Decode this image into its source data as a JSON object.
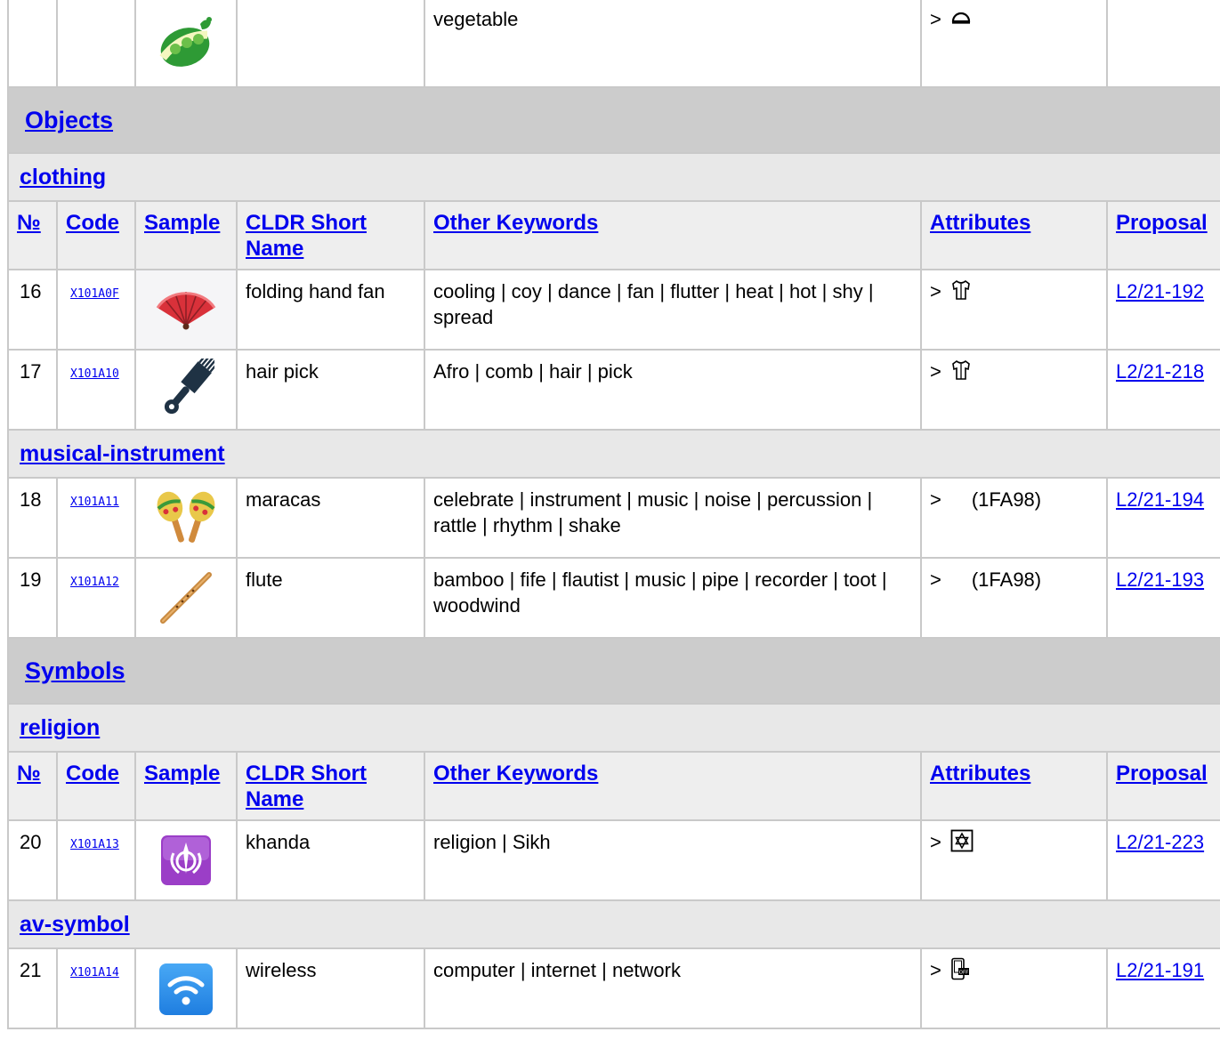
{
  "top_row": {
    "keywords": "vegetable",
    "attr_arrow": ">",
    "icon": "vegetable-emoji-icon"
  },
  "headers": {
    "no": "№",
    "code": "Code",
    "sample": "Sample",
    "name": "CLDR Short Name",
    "keywords": "Other Keywords",
    "attributes": "Attributes",
    "proposal": "Proposal"
  },
  "sections": [
    {
      "title": "Objects",
      "subgroups": [
        {
          "title": "clothing",
          "rows": [
            {
              "no": "16",
              "code": "X101A0F",
              "icon": "folding-fan-icon",
              "name": "folding hand fan",
              "keywords": "cooling | coy | dance | fan | flutter | heat | hot | shy | spread",
              "arrow": ">",
              "attr_icon": "shirt-icon",
              "proposal": "L2/21-192"
            },
            {
              "no": "17",
              "code": "X101A10",
              "icon": "hair-pick-icon",
              "name": "hair pick",
              "keywords": "Afro | comb | hair | pick",
              "arrow": ">",
              "attr_icon": "shirt-icon",
              "proposal": "L2/21-218"
            }
          ]
        },
        {
          "title": "musical-instrument",
          "rows": [
            {
              "no": "18",
              "code": "X101A11",
              "icon": "maracas-icon",
              "name": "maracas",
              "keywords": "celebrate | instrument | music | noise | percussion | rattle | rhythm | shake",
              "arrow": ">",
              "attr_text": "(1FA98)",
              "proposal": "L2/21-194"
            },
            {
              "no": "19",
              "code": "X101A12",
              "icon": "flute-icon",
              "name": "flute",
              "keywords": "bamboo | fife | flautist | music | pipe | recorder | toot | woodwind",
              "arrow": ">",
              "attr_text": "(1FA98)",
              "proposal": "L2/21-193"
            }
          ]
        }
      ]
    },
    {
      "title": "Symbols",
      "subgroups": [
        {
          "title": "religion",
          "rows": [
            {
              "no": "20",
              "code": "X101A13",
              "icon": "khanda-icon",
              "name": "khanda",
              "keywords": "religion | Sikh",
              "arrow": ">",
              "attr_icon": "star-of-david-box-icon",
              "proposal": "L2/21-223"
            }
          ]
        },
        {
          "title": "av-symbol",
          "rows": [
            {
              "no": "21",
              "code": "X101A14",
              "icon": "wireless-icon",
              "name": "wireless",
              "keywords": "computer | internet | network",
              "arrow": ">",
              "attr_icon": "mobile-phone-off-icon",
              "proposal": "L2/21-191"
            }
          ]
        }
      ]
    }
  ]
}
